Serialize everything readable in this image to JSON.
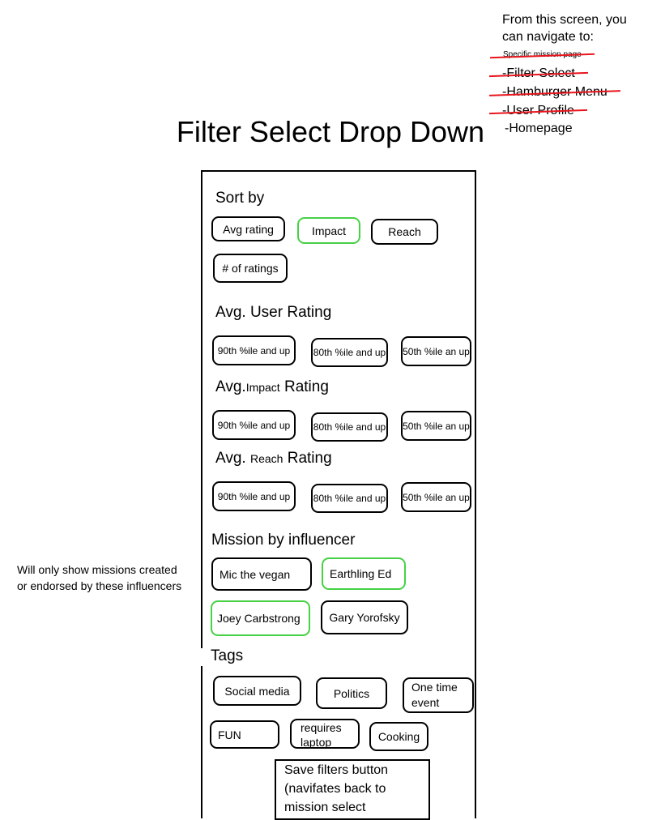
{
  "nav_note": {
    "intro": "From this screen, you can navigate to:",
    "items": [
      {
        "label": "Specific mission page",
        "struck": true
      },
      {
        "label": "-Filter Select",
        "struck": true
      },
      {
        "label": "-Hamburger Menu",
        "struck": true
      },
      {
        "label": "-User Profile",
        "struck": true
      },
      {
        "label": "-Homepage",
        "struck": false
      }
    ]
  },
  "title": "Filter Select Drop Down",
  "filter_panel": {
    "sort_by": {
      "heading": "Sort by",
      "options": [
        "Avg rating",
        "Impact",
        "Reach",
        "# of ratings"
      ],
      "selected": "Impact"
    },
    "avg_user_rating": {
      "heading": "Avg. User Rating",
      "options": [
        "90th %ile and up",
        "80th %ile and up",
        "50th %ile an up"
      ]
    },
    "avg_impact_rating": {
      "heading_prefix": "Avg.",
      "heading_small": "Impact",
      "heading_suffix": "Rating",
      "options": [
        "90th %ile and up",
        "80th %ile and up",
        "50th %ile an up"
      ]
    },
    "avg_reach_rating": {
      "heading_prefix": "Avg.",
      "heading_small": "Reach",
      "heading_suffix": "Rating",
      "options": [
        "90th %ile and up",
        "80th %ile and up",
        "50th %ile an up"
      ]
    },
    "mission_by_influencer": {
      "heading": "Mission by influencer",
      "options": [
        "Mic the vegan",
        "Earthling Ed",
        "Joey Carbstrong",
        "Gary Yorofsky"
      ],
      "selected": [
        "Earthling Ed",
        "Joey Carbstrong"
      ]
    },
    "tags": {
      "heading": "Tags",
      "options": [
        "Social media",
        "Politics",
        "One time event",
        "FUN",
        "requires laptop",
        "Cooking"
      ]
    },
    "save_button": "Save filters button (navifates back to mission select homepage)"
  },
  "side_note": "Will only show missions created or endorsed by these influencers",
  "colors": {
    "selected_border": "#46d146",
    "strike": "#e8141c"
  }
}
